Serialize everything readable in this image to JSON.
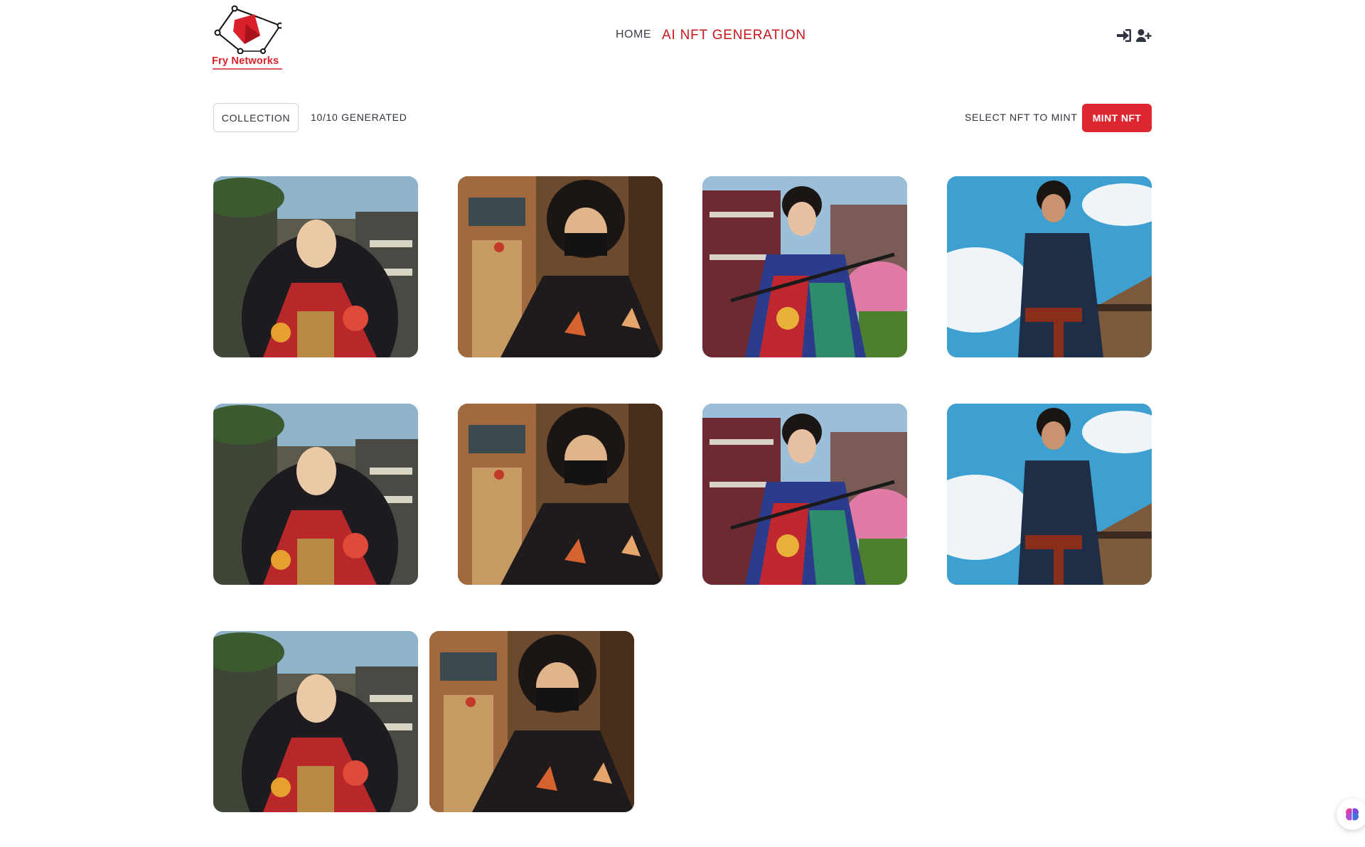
{
  "header": {
    "brand_name": "Fry Networks",
    "nav": {
      "home": "HOME",
      "ai_nft_generation": "AI NFT GENERATION"
    },
    "icons": [
      "sign-in-icon",
      "user-plus-icon"
    ],
    "brand_color": "#d9202a"
  },
  "toolbar": {
    "collection_label": "COLLECTION",
    "generated_count": "10/10 GENERATED",
    "select_hint": "SELECT NFT TO MINT",
    "mint_label": "MINT NFT",
    "mint_color": "#de2631"
  },
  "gallery": {
    "items": [
      {
        "subject": "long-haired samurai in red floral kimono, townhouse backdrop"
      },
      {
        "subject": "masked ninja in dark floral kimono, wooden interior"
      },
      {
        "subject": "samurai in colorful patterned kimono with katana, pagoda and blossoms"
      },
      {
        "subject": "samurai in dark blue robe, blue sky and clouds, temple roof"
      },
      {
        "subject": "long-haired samurai in red floral kimono, townhouse backdrop"
      },
      {
        "subject": "masked ninja in dark floral kimono, wooden interior"
      },
      {
        "subject": "samurai in colorful patterned kimono with katana, pagoda and blossoms"
      },
      {
        "subject": "samurai in dark blue robe, blue sky and clouds, temple roof"
      },
      {
        "subject": "long-haired samurai in red floral kimono, townhouse backdrop"
      },
      {
        "subject": "masked ninja in dark floral kimono, wooden interior"
      }
    ]
  },
  "floating_widget": {
    "icon": "brain-icon"
  }
}
